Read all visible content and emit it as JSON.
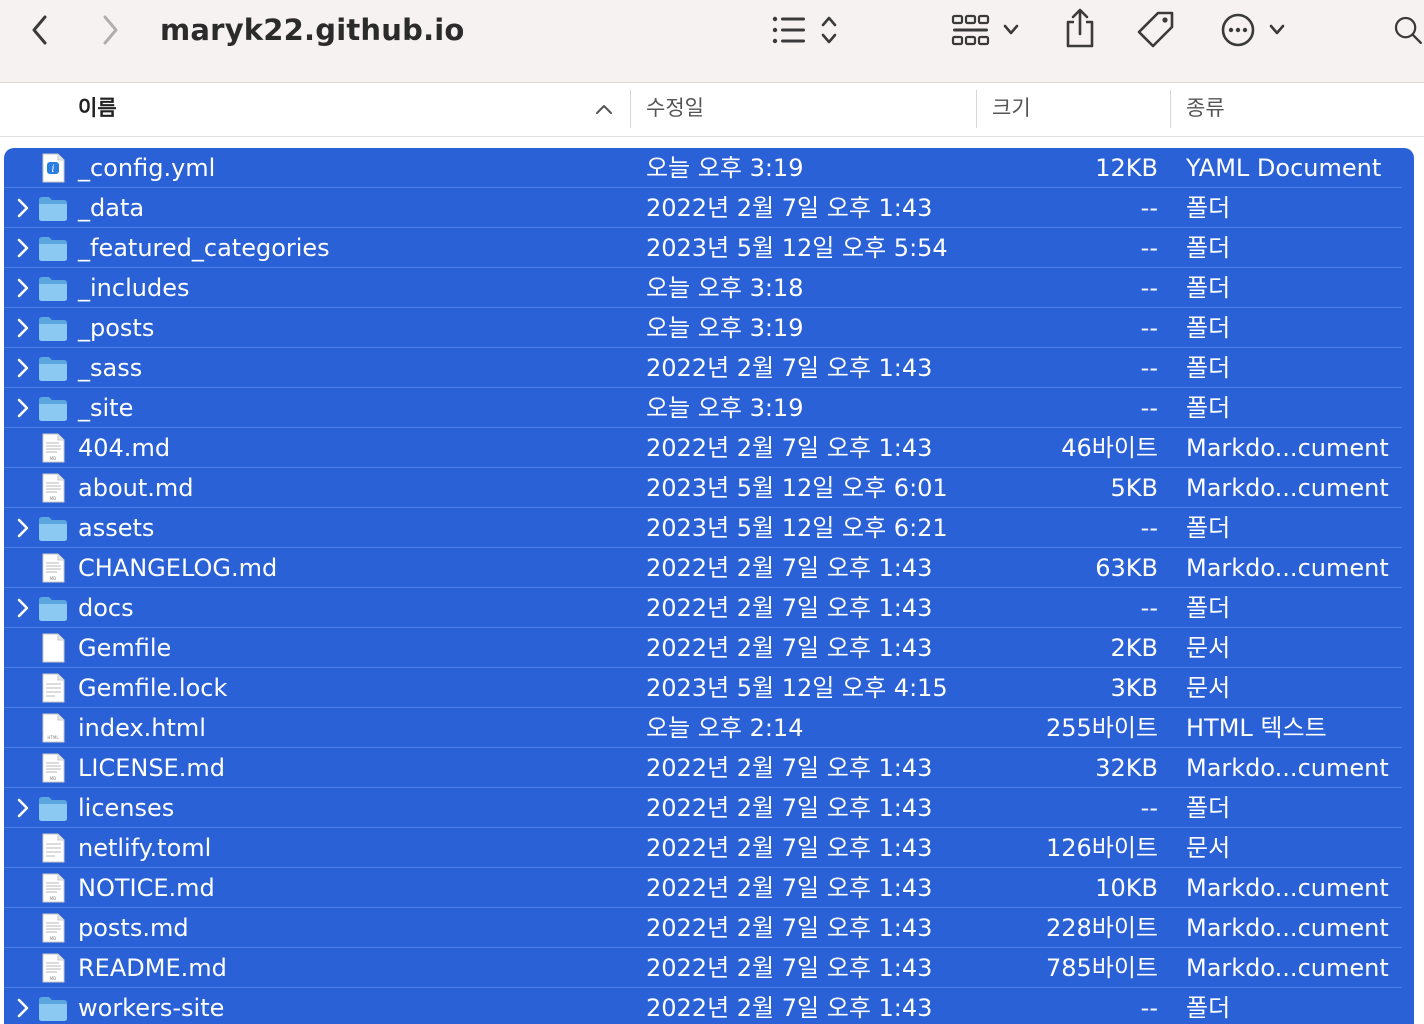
{
  "window": {
    "title": "maryk22.github.io",
    "accent_color": "#2a61d6"
  },
  "toolbar": {
    "back_icon": "chevron-left-icon",
    "forward_icon": "chevron-right-icon",
    "view_icon": "list-view-icon",
    "group_icon": "grid-group-icon",
    "share_icon": "share-icon",
    "tag_icon": "tag-icon",
    "more_icon": "ellipsis-circle-icon",
    "search_icon": "search-icon"
  },
  "columns": {
    "name": "이름",
    "modified": "수정일",
    "size": "크기",
    "kind": "종류"
  },
  "files": [
    {
      "name": "_config.yml",
      "date": "오늘 오후 3:19",
      "size": "12KB",
      "kind": "YAML Document",
      "type": "yaml"
    },
    {
      "name": "_data",
      "date": "2022년 2월 7일 오후 1:43",
      "size": "--",
      "kind": "폴더",
      "type": "folder"
    },
    {
      "name": "_featured_categories",
      "date": "2023년 5월 12일 오후 5:54",
      "size": "--",
      "kind": "폴더",
      "type": "folder"
    },
    {
      "name": "_includes",
      "date": "오늘 오후 3:18",
      "size": "--",
      "kind": "폴더",
      "type": "folder"
    },
    {
      "name": "_posts",
      "date": "오늘 오후 3:19",
      "size": "--",
      "kind": "폴더",
      "type": "folder"
    },
    {
      "name": "_sass",
      "date": "2022년 2월 7일 오후 1:43",
      "size": "--",
      "kind": "폴더",
      "type": "folder"
    },
    {
      "name": "_site",
      "date": "오늘 오후 3:19",
      "size": "--",
      "kind": "폴더",
      "type": "folder"
    },
    {
      "name": "404.md",
      "date": "2022년 2월 7일 오후 1:43",
      "size": "46바이트",
      "kind": "Markdo...cument",
      "type": "doc"
    },
    {
      "name": "about.md",
      "date": "2023년 5월 12일 오후 6:01",
      "size": "5KB",
      "kind": "Markdo...cument",
      "type": "doc"
    },
    {
      "name": "assets",
      "date": "2023년 5월 12일 오후 6:21",
      "size": "--",
      "kind": "폴더",
      "type": "folder"
    },
    {
      "name": "CHANGELOG.md",
      "date": "2022년 2월 7일 오후 1:43",
      "size": "63KB",
      "kind": "Markdo...cument",
      "type": "doc"
    },
    {
      "name": "docs",
      "date": "2022년 2월 7일 오후 1:43",
      "size": "--",
      "kind": "폴더",
      "type": "folder"
    },
    {
      "name": "Gemfile",
      "date": "2022년 2월 7일 오후 1:43",
      "size": "2KB",
      "kind": "문서",
      "type": "blank"
    },
    {
      "name": "Gemfile.lock",
      "date": "2023년 5월 12일 오후 4:15",
      "size": "3KB",
      "kind": "문서",
      "type": "text"
    },
    {
      "name": "index.html",
      "date": "오늘 오후 2:14",
      "size": "255바이트",
      "kind": "HTML 텍스트",
      "type": "html"
    },
    {
      "name": "LICENSE.md",
      "date": "2022년 2월 7일 오후 1:43",
      "size": "32KB",
      "kind": "Markdo...cument",
      "type": "doc"
    },
    {
      "name": "licenses",
      "date": "2022년 2월 7일 오후 1:43",
      "size": "--",
      "kind": "폴더",
      "type": "folder"
    },
    {
      "name": "netlify.toml",
      "date": "2022년 2월 7일 오후 1:43",
      "size": "126바이트",
      "kind": "문서",
      "type": "text"
    },
    {
      "name": "NOTICE.md",
      "date": "2022년 2월 7일 오후 1:43",
      "size": "10KB",
      "kind": "Markdo...cument",
      "type": "doc"
    },
    {
      "name": "posts.md",
      "date": "2022년 2월 7일 오후 1:43",
      "size": "228바이트",
      "kind": "Markdo...cument",
      "type": "doc"
    },
    {
      "name": "README.md",
      "date": "2022년 2월 7일 오후 1:43",
      "size": "785바이트",
      "kind": "Markdo...cument",
      "type": "doc"
    },
    {
      "name": "workers-site",
      "date": "2022년 2월 7일 오후 1:43",
      "size": "--",
      "kind": "폴더",
      "type": "folder"
    }
  ]
}
